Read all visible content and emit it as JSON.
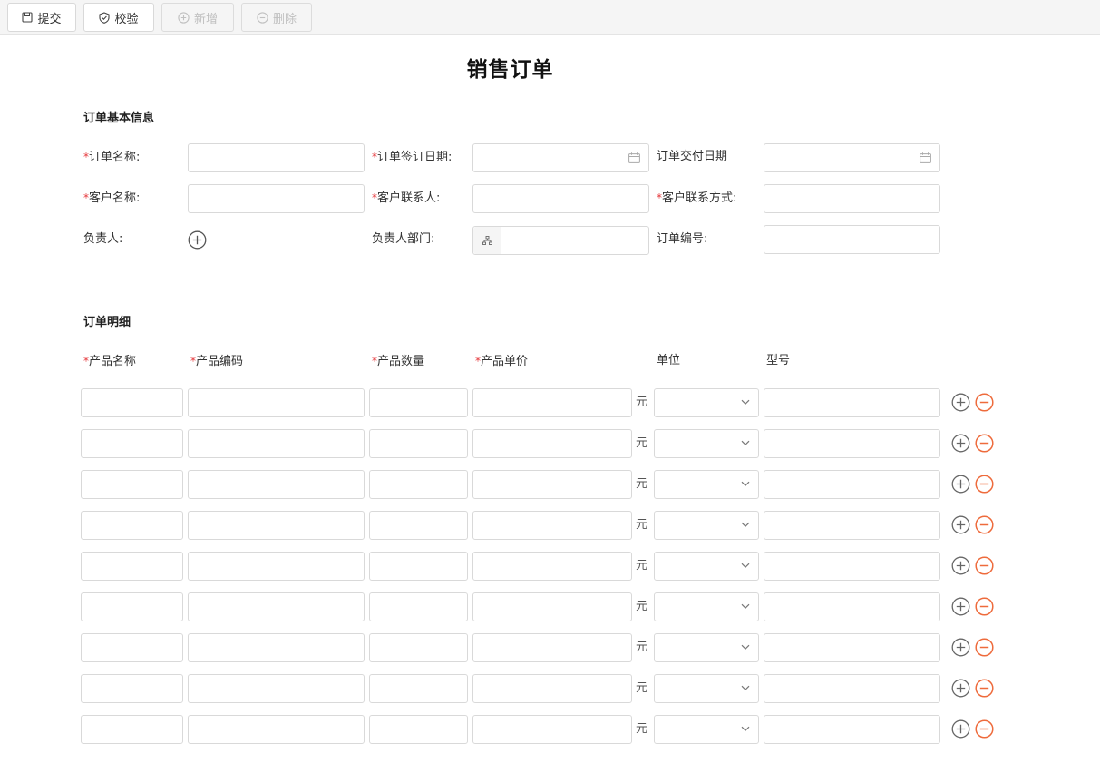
{
  "toolbar": {
    "submit": "提交",
    "verify": "校验",
    "add": "新增",
    "delete": "删除"
  },
  "page_title": "销售订单",
  "basic_section": {
    "title": "订单基本信息",
    "order_name": "订单名称:",
    "sign_date": "订单签订日期:",
    "delivery_date": "订单交付日期",
    "customer_name": "客户名称:",
    "customer_contact": "客户联系人:",
    "customer_phone": "客户联系方式:",
    "owner": "负责人:",
    "owner_dept": "负责人部门:",
    "order_no": "订单编号:"
  },
  "detail_section": {
    "title": "订单明细",
    "columns": {
      "product_name": "产品名称",
      "product_code": "产品编码",
      "quantity": "产品数量",
      "unit_price": "产品单价",
      "unit": "单位",
      "model": "型号"
    },
    "currency": "元",
    "row_count": 9
  },
  "colors": {
    "required": "#e5363a",
    "remove": "#ee6b3c",
    "add": "#666666"
  }
}
